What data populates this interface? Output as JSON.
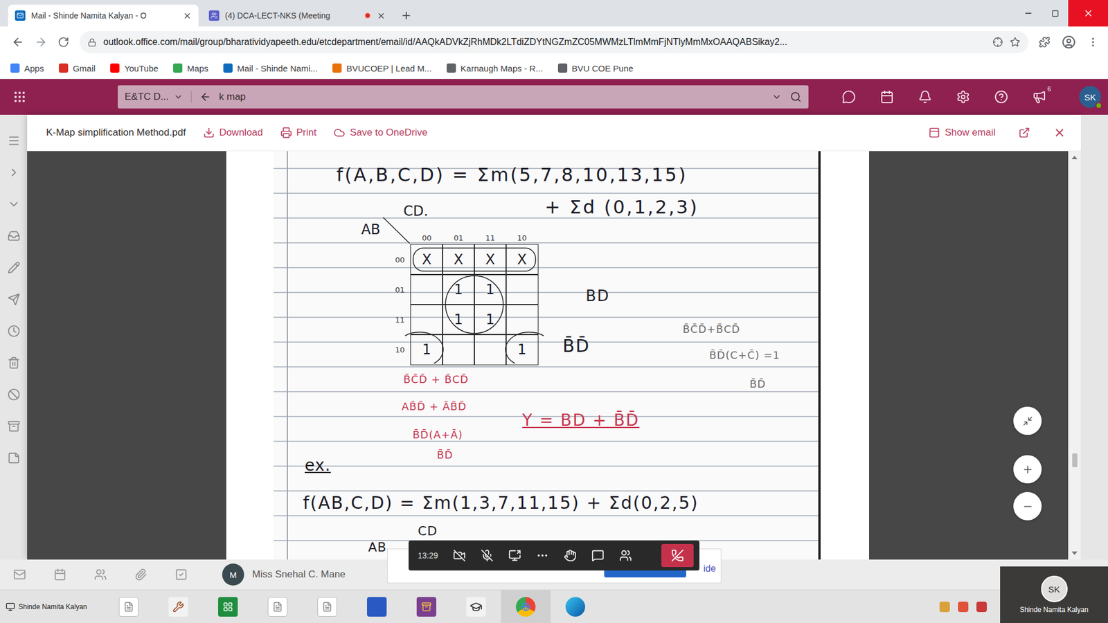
{
  "browser": {
    "tabs": [
      {
        "label": "Mail - Shinde Namita Kalyan - O",
        "selected": true,
        "recording": false
      },
      {
        "label": "(4) DCA-LECT-NKS (Meeting",
        "selected": false,
        "recording": true
      }
    ],
    "url": "outlook.office.com/mail/group/bharatividyapeeth.edu/etcdepartment/email/id/AAQkADVkZjRhMDk2LTdiZDYtNGZmZC05MWMzLTlmMmFjNTlyMmMxOAAQABSikay2...",
    "bookmarks": [
      {
        "label": "Apps",
        "color": "#4285f4"
      },
      {
        "label": "Gmail",
        "color": "#d93025"
      },
      {
        "label": "YouTube",
        "color": "#ff0000"
      },
      {
        "label": "Maps",
        "color": "#34a853"
      },
      {
        "label": "Mail - Shinde Nami...",
        "color": "#0f6cbd"
      },
      {
        "label": "BVUCOEP | Lead M...",
        "color": "#e8710a"
      },
      {
        "label": "Karnaugh Maps - R...",
        "color": "#5f6368"
      },
      {
        "label": "BVU COE Pune",
        "color": "#5f6368"
      }
    ]
  },
  "outlook": {
    "folder": "E&TC D...",
    "search": "k map",
    "notifications": "6",
    "avatar": "SK"
  },
  "viewer": {
    "file": "K-Map simplification Method.pdf",
    "actions": [
      "Download",
      "Print",
      "Save to OneDrive"
    ],
    "show_email": "Show email"
  },
  "document": {
    "kmap": {
      "row_header": "AB",
      "col_header": "CD.",
      "columns": [
        "00",
        "01",
        "11",
        "10"
      ],
      "rows": [
        {
          "label": "00",
          "cells": [
            "X",
            "X",
            "X",
            "X"
          ]
        },
        {
          "label": "01",
          "cells": [
            "",
            "1",
            "1",
            ""
          ]
        },
        {
          "label": "11",
          "cells": [
            "",
            "1",
            "1",
            ""
          ]
        },
        {
          "label": "10",
          "cells": [
            "1",
            "",
            "",
            "1"
          ]
        }
      ]
    },
    "notes": [
      {
        "text": "f(A,B,C,D) = Σm(5,7,8,10,13,15)",
        "color": "#1c1c28",
        "underlined": false
      },
      {
        "text": "+ Σd (0,1,2,3)",
        "color": "#1c1c28",
        "underlined": false
      },
      {
        "text": "BD",
        "color": "#1c1c28",
        "underlined": false
      },
      {
        "text": "B̄D̄",
        "color": "#1c1c28",
        "underlined": false
      },
      {
        "text": "B̄C̄D̄+B̄CD̄",
        "color": "#6b6b6b",
        "underlined": false
      },
      {
        "text": "B̄D̄(C+C̄) =1",
        "color": "#6b6b6b",
        "underlined": false
      },
      {
        "text": "B̄D̄",
        "color": "#6b6b6b",
        "underlined": false
      },
      {
        "text": "B̄C̄D̄ + B̄CD̄",
        "color": "#c8364f",
        "underlined": false
      },
      {
        "text": "AB̄D̄ + ĀB̄D̄",
        "color": "#c8364f",
        "underlined": false
      },
      {
        "text": "B̄D̄(A+Ā)",
        "color": "#c8364f",
        "underlined": false
      },
      {
        "text": "B̄D̄",
        "color": "#c8364f",
        "underlined": false
      },
      {
        "text": "Y = BD + B̄D̄",
        "color": "#c8364f",
        "underlined": true
      },
      {
        "text": "ex.",
        "color": "#1c1c28",
        "underlined": true
      },
      {
        "text": "f(AB,C,D) = Σm(1,3,7,11,15) + Σd(0,2,5)",
        "color": "#1c1c28",
        "underlined": false
      },
      {
        "text": "CD",
        "color": "#1c1c28",
        "underlined": false
      },
      {
        "text": "AB",
        "color": "#1c1c28",
        "underlined": false
      }
    ]
  },
  "meeting": {
    "time": "13:29",
    "hide_label": "ide"
  },
  "reading_pane": {
    "sender": "Miss Snehal C. Mane",
    "avatar": "M"
  },
  "taskbar": {
    "window_label": "Shinde Namita Kalyan"
  },
  "video_tile": {
    "initials": "SK",
    "name": "Shinde Namita Kalyan"
  }
}
